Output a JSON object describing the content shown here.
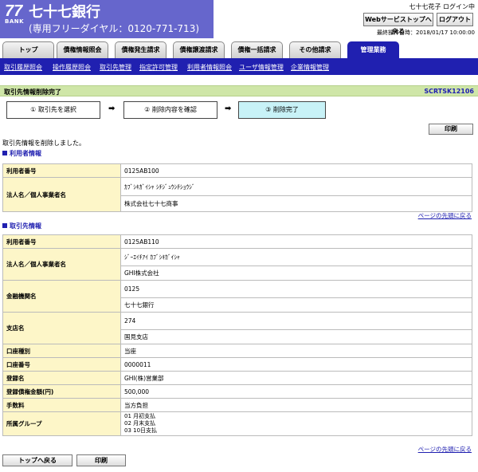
{
  "header": {
    "logo_number": "77",
    "logo_bank": "BANK",
    "bank_name": "七十七銀行",
    "dial": "(専用フリーダイヤル：0120-771-713)",
    "user_status": "七十七花子 ログイン中",
    "top_button": "Webサービストップへ戻る",
    "logout_button": "ログアウト",
    "last_operation": "最終操作日時：2018/01/17 10:00:00"
  },
  "tabs": [
    "トップ",
    "債権情報照会",
    "債権発生請求",
    "債権譲渡請求",
    "債権一括請求",
    "その他請求",
    "管理業務"
  ],
  "subnav": [
    "取引履歴照会",
    "操作履歴照会",
    "取引先管理",
    "指定許可管理",
    "利用者情報照会",
    "ユーザ情報管理",
    "企業情報管理"
  ],
  "title": {
    "text": "取引先情報削除完了",
    "screen_id": "SCRTSK12106"
  },
  "steps": [
    "① 取引先を選択",
    "② 削除内容を確認",
    "③ 削除完了"
  ],
  "arrow": "➡",
  "print_label": "印刷",
  "completion_message": "取引先情報を削除しました。",
  "user_section": {
    "heading": "利用者情報",
    "rows": [
      {
        "label": "利用者番号",
        "values": [
          "0125AB100"
        ]
      },
      {
        "label": "法人名／個人事業者名",
        "values": [
          "ｶﾌﾞｼｷｶﾞｲｼｬ ｼﾁｼﾞｭｳｼﾁｼｮｳｼﾞ",
          "株式会社七十七商事"
        ]
      }
    ]
  },
  "page_top_link": "ページの先頭に戻る",
  "partner_section": {
    "heading": "取引先情報",
    "rows": [
      {
        "label": "利用者番号",
        "values": [
          "0125AB110"
        ]
      },
      {
        "label": "法人名／個人事業者名",
        "values": [
          "ｼﾞｰｴｲﾁｱｲ ｶﾌﾞｼｷｶﾞｲｼｬ",
          "GHI株式会社"
        ]
      },
      {
        "label": "金融機関名",
        "values": [
          "0125",
          "七十七銀行"
        ]
      },
      {
        "label": "支店名",
        "values": [
          "274",
          "国見支店"
        ]
      },
      {
        "label": "口座種別",
        "values": [
          "当座"
        ]
      },
      {
        "label": "口座番号",
        "values": [
          "0000011"
        ]
      },
      {
        "label": "登録名",
        "values": [
          "GHI(株)営業部"
        ]
      },
      {
        "label": "登録債権金額(円)",
        "values": [
          "500,000"
        ]
      },
      {
        "label": "手数料",
        "values": [
          "当方負担"
        ]
      },
      {
        "label": "所属グループ",
        "values": [
          "01 月初支払",
          "02 月末支払",
          "03 10日支払"
        ]
      }
    ]
  },
  "bottom": {
    "back_label": "トップへ戻る",
    "print_label": "印刷"
  }
}
